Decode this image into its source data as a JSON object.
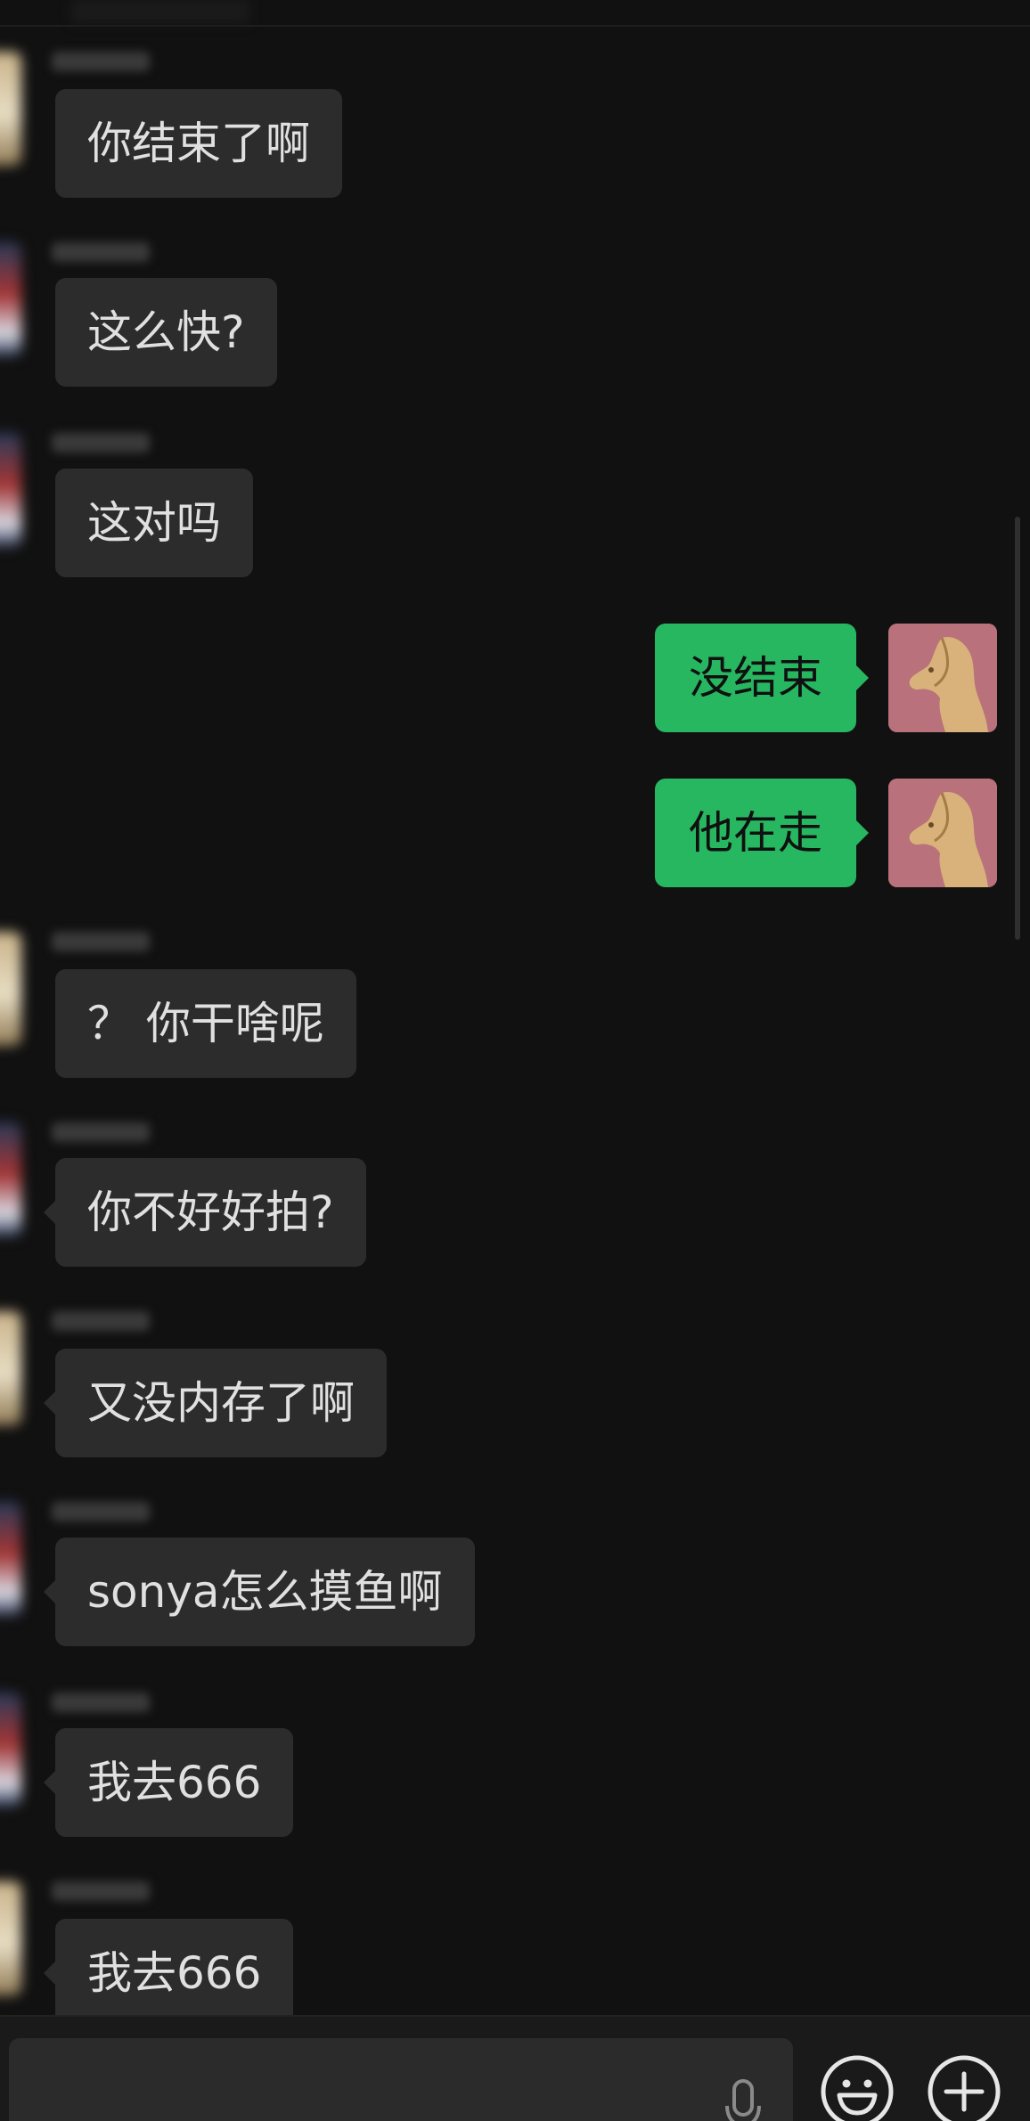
{
  "chat": {
    "messages": [
      {
        "side": "left",
        "avatar": "cream",
        "text": "你结束了啊"
      },
      {
        "side": "left",
        "avatar": "red",
        "text": "这么快?"
      },
      {
        "side": "left",
        "avatar": "red",
        "text": "这对吗"
      },
      {
        "side": "right",
        "avatar": "horse",
        "text": "没结束"
      },
      {
        "side": "right",
        "avatar": "horse",
        "text": "他在走"
      },
      {
        "side": "left",
        "avatar": "cream",
        "text": "？ 你干啥呢"
      },
      {
        "side": "left",
        "avatar": "red",
        "text": "你不好好拍?"
      },
      {
        "side": "left",
        "avatar": "cream",
        "text": "又没内存了啊"
      },
      {
        "side": "left",
        "avatar": "red",
        "text": "sonya怎么摸鱼啊"
      },
      {
        "side": "left",
        "avatar": "red",
        "text": "我去666"
      },
      {
        "side": "left",
        "avatar": "cream",
        "text": "我去666"
      }
    ]
  },
  "input_bar": {
    "icons": {
      "voice": "microphone-icon",
      "emoji": "smiley-face-icon",
      "more": "plus-circle-icon"
    }
  },
  "colors": {
    "background": "#111111",
    "incoming_bubble": "#2c2c2c",
    "outgoing_bubble": "#27b760",
    "incoming_text": "#e0e0e0",
    "outgoing_text": "#101010"
  }
}
